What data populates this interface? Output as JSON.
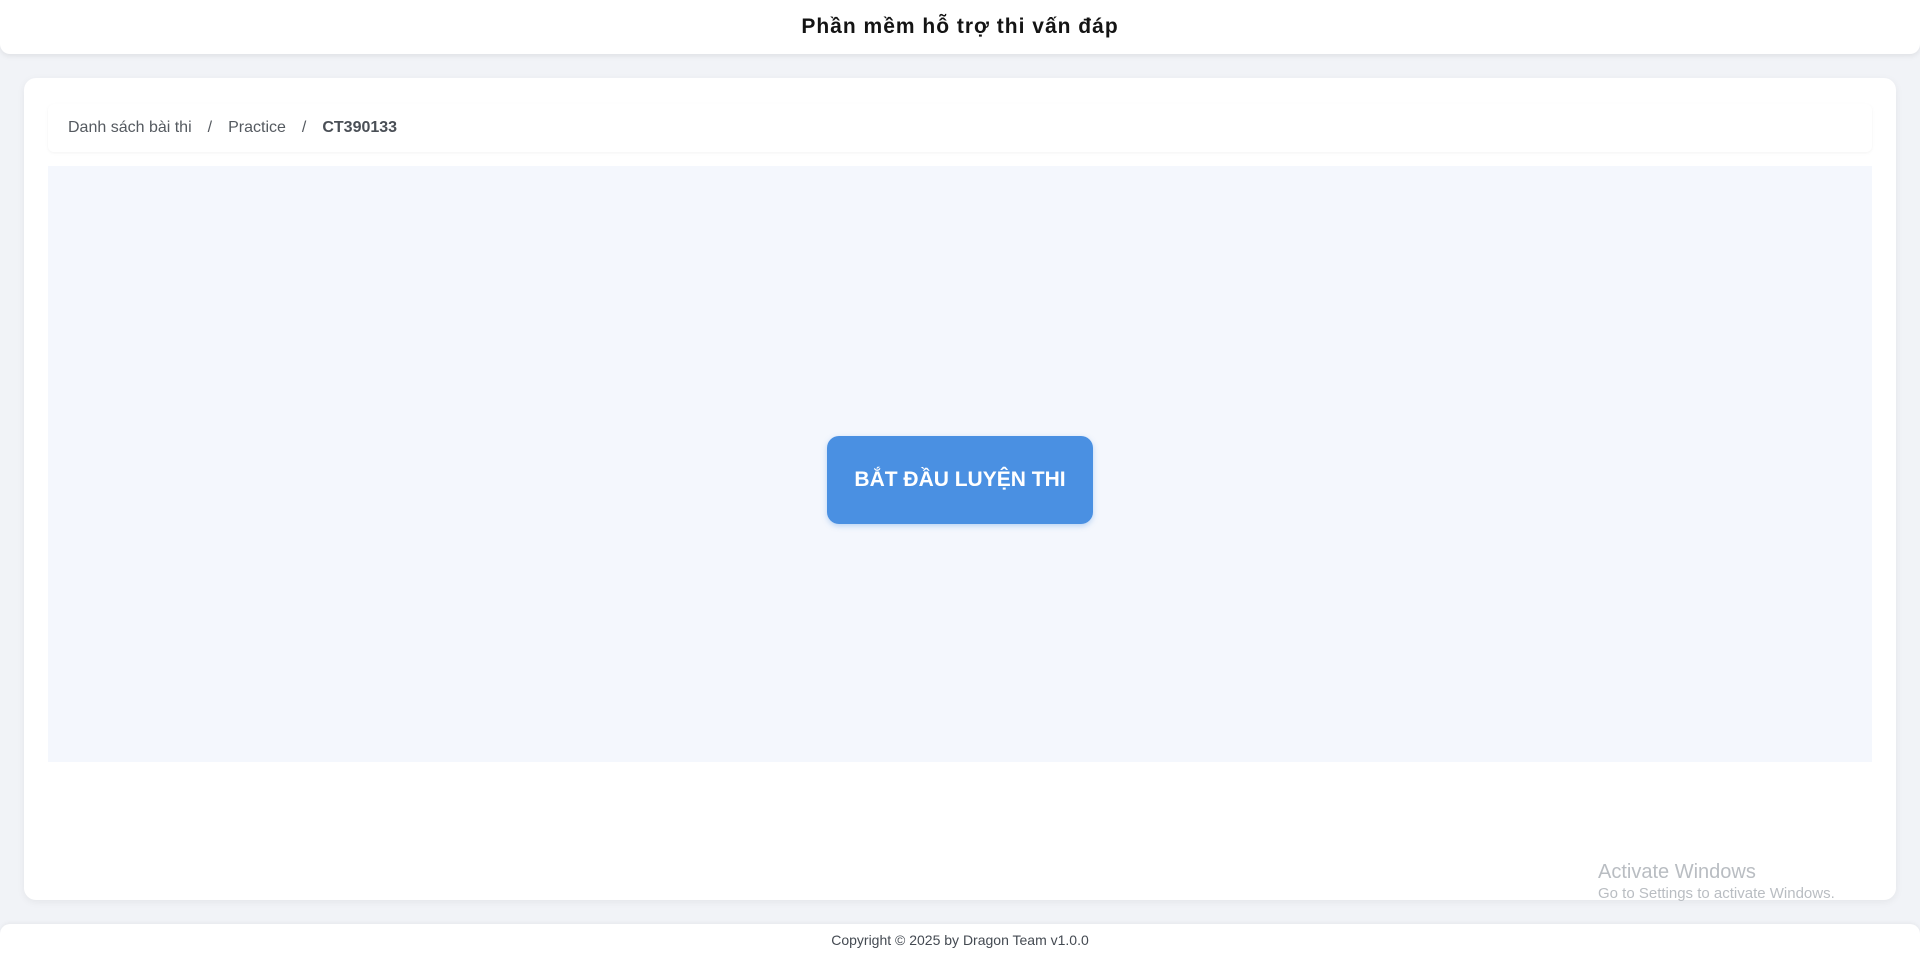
{
  "header": {
    "title": "Phần mềm hỗ trợ thi vấn đáp"
  },
  "breadcrumb": {
    "items": [
      "Danh sách bài thi",
      "Practice",
      "CT390133"
    ],
    "separator": "/"
  },
  "practice": {
    "start_label": "BẮT ĐẦU LUYỆN THI"
  },
  "watermark": {
    "title": "Activate Windows",
    "subtitle": "Go to Settings to activate Windows."
  },
  "footer": {
    "text": "Copyright © 2025 by Dragon Team v1.0.0"
  },
  "colors": {
    "accent": "#4a90e2",
    "page_background": "#f1f3f7",
    "practice_area_background": "#f4f7fd"
  }
}
